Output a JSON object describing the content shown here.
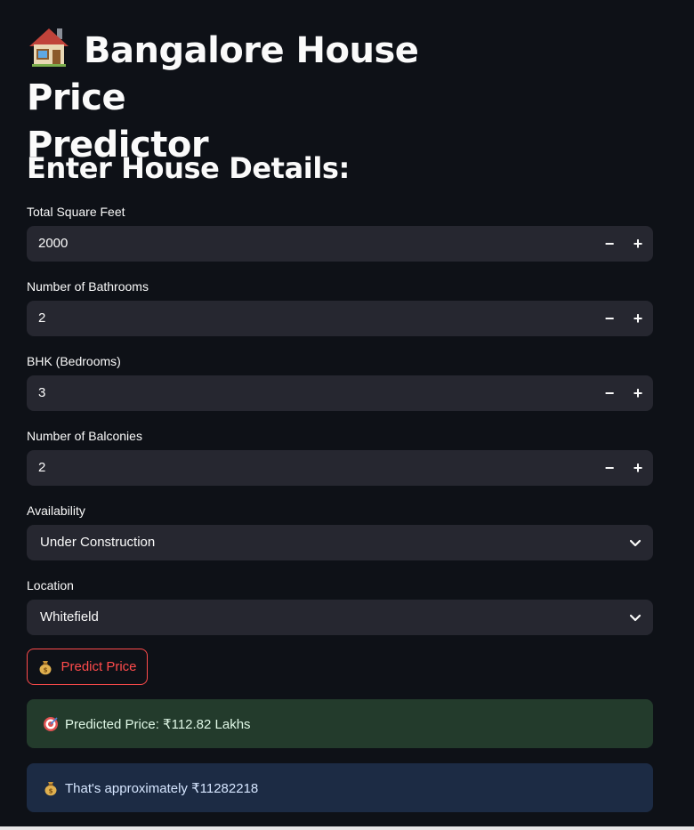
{
  "page": {
    "title_line1": "Bangalore House Price",
    "title_line2": "Predictor",
    "title_icon": "house-icon",
    "subheader": "Enter House Details:"
  },
  "form": {
    "sqft": {
      "label": "Total Square Feet",
      "value": "2000"
    },
    "bath": {
      "label": "Number of Bathrooms",
      "value": "2"
    },
    "bhk": {
      "label": "BHK (Bedrooms)",
      "value": "3"
    },
    "balcony": {
      "label": "Number of Balconies",
      "value": "2"
    },
    "availability": {
      "label": "Availability",
      "value": "Under Construction"
    },
    "location": {
      "label": "Location",
      "value": "Whitefield"
    },
    "stepper": {
      "minus": "−",
      "plus": "+"
    }
  },
  "button": {
    "label": "Predict Price",
    "icon": "money-bag-icon"
  },
  "results": {
    "predicted": "Predicted Price: ₹112.82 Lakhs",
    "predicted_icon": "target-icon",
    "approx": "That's approximately ₹11282218",
    "approx_icon": "money-bag-icon"
  },
  "colors": {
    "background": "#0e1117",
    "input_bg": "#262730",
    "accent": "#ff4b4b",
    "success_bg": "#233b2c",
    "info_bg": "#1c2b44"
  }
}
